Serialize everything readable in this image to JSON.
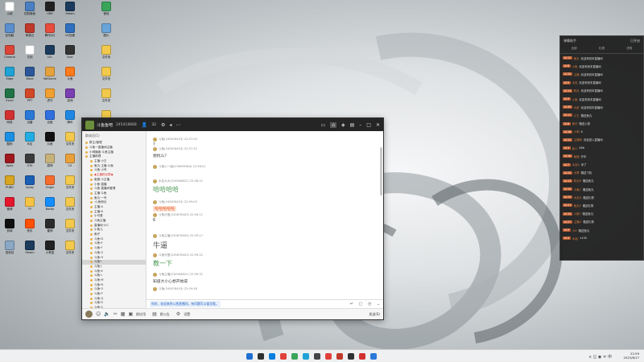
{
  "colors": {
    "accent_green": "#4b9a55",
    "danmu_bg": "#191919",
    "titlebar": "#252525"
  },
  "desktop": {
    "icons": [
      {
        "label": "火绒",
        "color": "#ffffff"
      },
      {
        "label": "控制面板",
        "color": "#4a7fc1"
      },
      {
        "label": "OBS",
        "color": "#222222"
      },
      {
        "label": "Steam",
        "color": "#1b3a5c"
      },
      {
        "label": "微信",
        "color": "#3aa55a"
      },
      {
        "label": "此电脑",
        "color": "#5a8fcf"
      },
      {
        "label": "网易云",
        "color": "#c0392b"
      },
      {
        "label": "腾讯QQ",
        "color": "#e74c3c"
      },
      {
        "label": "UU加速",
        "color": "#2f6fbf"
      },
      {
        "label": "图片",
        "color": "#6aa4d8"
      },
      {
        "label": "Chrome",
        "color": "#db4437"
      },
      {
        "label": "文档",
        "color": "#ffffff"
      },
      {
        "label": "LOL",
        "color": "#1b3a5c"
      },
      {
        "label": "Epic",
        "color": "#333333"
      },
      {
        "label": "文件夹",
        "color": "#f2c94c"
      },
      {
        "label": "Edge",
        "color": "#1fa2d6"
      },
      {
        "label": "Word",
        "color": "#2b579a"
      },
      {
        "label": "WeGame",
        "color": "#e5a23c"
      },
      {
        "label": "斗鱼",
        "color": "#ff7a1a"
      },
      {
        "label": "文件夹",
        "color": "#f2c94c"
      },
      {
        "label": "Excel",
        "color": "#217346"
      },
      {
        "label": "PPT",
        "color": "#d24726"
      },
      {
        "label": "虎牙",
        "color": "#f0a030"
      },
      {
        "label": "游戏",
        "color": "#7a3fb0"
      },
      {
        "label": "文件夹",
        "color": "#f2c94c"
      },
      {
        "label": "网易",
        "color": "#d23131"
      },
      {
        "label": "迅雷",
        "color": "#2a79d9"
      },
      {
        "label": "百度",
        "color": "#2f6fe0"
      },
      {
        "label": "腾讯",
        "color": "#1e88e5"
      },
      {
        "label": "资料",
        "color": "#f2c94c"
      },
      {
        "label": "酷狗",
        "color": "#1a8fe3"
      },
      {
        "label": "B站",
        "color": "#23ade5"
      },
      {
        "label": "抖音",
        "color": "#111111"
      },
      {
        "label": "文件夹",
        "color": "#f2c94c"
      },
      {
        "label": "文件夹",
        "color": "#f2c94c"
      },
      {
        "label": "Apex",
        "color": "#a0181e"
      },
      {
        "label": "GTA",
        "color": "#3b3b3b"
      },
      {
        "label": "原神",
        "color": "#c7b27a"
      },
      {
        "label": "CS",
        "color": "#e9a23b"
      },
      {
        "label": "文件夹",
        "color": "#f2c94c"
      },
      {
        "label": "PUBG",
        "color": "#d8a520"
      },
      {
        "label": "Uplay",
        "color": "#1a5fb4"
      },
      {
        "label": "Origin",
        "color": "#f56c2d"
      },
      {
        "label": "文件夹",
        "color": "#f2c94c"
      },
      {
        "label": "文件夹",
        "color": "#f2c94c"
      },
      {
        "label": "微博",
        "color": "#e6162d"
      },
      {
        "label": "YY",
        "color": "#f6c343"
      },
      {
        "label": "Battle",
        "color": "#148eff"
      },
      {
        "label": "文件夹",
        "color": "#f2c94c"
      },
      {
        "label": "文件夹",
        "color": "#f2c94c"
      },
      {
        "label": "剪映",
        "color": "#101010"
      },
      {
        "label": "快手",
        "color": "#ff5000"
      },
      {
        "label": "雷神",
        "color": "#2b2b2b"
      },
      {
        "label": "文件夹",
        "color": "#f2c94c"
      },
      {
        "label": "文件夹",
        "color": "#f2c94c"
      },
      {
        "label": "回收站",
        "color": "#8aa7c4"
      },
      {
        "label": "Steam",
        "color": "#1b3a5c"
      },
      {
        "label": "小黑盒",
        "color": "#222222"
      },
      {
        "label": "文件夹",
        "color": "#f2c94c"
      },
      {
        "label": "文件夹",
        "color": "#f2c94c"
      }
    ]
  },
  "chat": {
    "title": "斗鱼鱼吧",
    "id": "245418668",
    "member_count": "32",
    "sidebar_header": "群成员(1)",
    "members": [
      {
        "name": "群主/管理",
        "sel": false
      },
      {
        "name": "斗鱼一直播间主播",
        "sel": false
      },
      {
        "name": "小明播客·斗鱼主播",
        "sel": false
      },
      {
        "name": "主播助理",
        "sel": false
      },
      {
        "name": "主播·小王",
        "sel": false
      },
      {
        "name": "鱼丸·主播·斗鱼",
        "sel": false
      },
      {
        "name": "斗鱼·小号",
        "sel": false
      },
      {
        "name": "◆主播粉丝群◆",
        "sel": false
      },
      {
        "name": "鱼翅·小主播",
        "sel": false
      },
      {
        "name": "小鱼·直播",
        "sel": false
      },
      {
        "name": "斗鱼·直播间管理",
        "sel": false
      },
      {
        "name": "主播·斗鱼",
        "sel": false
      },
      {
        "name": "鱼丸·一号",
        "sel": false
      },
      {
        "name": "·小鱼粉丝",
        "sel": false
      },
      {
        "name": "主播·A",
        "sel": false
      },
      {
        "name": "主播·B",
        "sel": false
      },
      {
        "name": "小可爱",
        "sel": false
      },
      {
        "name": "斗鱼主播",
        "sel": false
      },
      {
        "name": "直播间·小C",
        "sel": false
      },
      {
        "name": "小鱼儿",
        "sel": false
      },
      {
        "name": "鱼仔",
        "sel": false
      },
      {
        "name": "斗鱼·D",
        "sel": false
      },
      {
        "name": "斗鱼·E",
        "sel": false
      },
      {
        "name": "斗鱼·F",
        "sel": false
      },
      {
        "name": "斗鱼·G",
        "sel": false
      },
      {
        "name": "斗鱼·H",
        "sel": false
      },
      {
        "name": "斗鱼·I",
        "sel": true
      },
      {
        "name": "斗鱼·J",
        "sel": false
      },
      {
        "name": "斗鱼·K",
        "sel": false
      },
      {
        "name": "斗鱼·L",
        "sel": false
      },
      {
        "name": "斗鱼·M",
        "sel": false
      },
      {
        "name": "斗鱼·N",
        "sel": false
      },
      {
        "name": "斗鱼·O",
        "sel": false
      },
      {
        "name": "斗鱼·P",
        "sel": false
      },
      {
        "name": "斗鱼·Q",
        "sel": false
      },
      {
        "name": "斗鱼·R",
        "sel": false
      },
      {
        "name": "斗鱼·S",
        "sel": false
      },
      {
        "name": "斗鱼·T",
        "sel": false
      }
    ],
    "messages": [
      {
        "meta": "斗鱼(245876403) 22:57:00",
        "body": "?",
        "style": ""
      },
      {
        "meta": "斗鱼(245876403) 22:57:32",
        "body": "想找么？",
        "style": ""
      },
      {
        "meta": "斗鱼小一级(476899384) 22:58:01",
        "body": "",
        "style": ""
      },
      {
        "meta": "水友大大(234948622) 22:58:21",
        "body": "哈哈哈哈",
        "style": "big"
      },
      {
        "meta": "斗鱼(245876403) 22:59:03",
        "body": "哈哈哈哈哈",
        "style": "red"
      },
      {
        "meta": "斗鱼可爱(245876403) 22:59:11",
        "body": "6",
        "style": ""
      },
      {
        "meta": "斗鱼主播(245876403) 22:59:17",
        "body": "牛逼",
        "style": "big2"
      },
      {
        "meta": "斗鱼可爱(245876403) 22:59:22",
        "body": "教一下",
        "style": "big"
      },
      {
        "meta": "斗鱼主播(234948622) 22:59:31",
        "body": "知道大小心想开始说",
        "style": ""
      },
      {
        "meta": "斗鱼(245876403) 22:59:38",
        "body": "",
        "style": ""
      }
    ],
    "input_text": "你好，欢迎来到斗鱼直播间，有问题可以留言哦。",
    "bottom_labels": [
      "群应用",
      "群公告",
      "设置"
    ],
    "send_label": "发送(S)"
  },
  "danmu": {
    "header": "弹幕助手",
    "header_right": "已开启",
    "tabs": [
      "全部",
      "礼物",
      "进场"
    ],
    "items": [
      {
        "tag": "LV.12",
        "name": "鱼丸",
        "text": "欢迎来到本直播间"
      },
      {
        "tag": "LV.8",
        "name": "小鱼",
        "text": "欢迎来到本直播间"
      },
      {
        "tag": "LV.20",
        "name": "主播",
        "text": "欢迎来到本直播间"
      },
      {
        "tag": "LV.5",
        "name": "水友",
        "text": "欢迎来到本直播间"
      },
      {
        "tag": "LV.14",
        "name": "粉丝",
        "text": "欢迎来到本直播间"
      },
      {
        "tag": "LV.9",
        "name": "斗鱼",
        "text": "欢迎来到本直播间"
      },
      {
        "tag": "LV.30",
        "name": "大佬",
        "text": "欢迎来到本直播间"
      },
      {
        "tag": "LV.11",
        "name": "小王",
        "text": "赠送鱼丸"
      },
      {
        "tag": "LV.6",
        "name": "鱼仔",
        "text": "赠送火箭"
      },
      {
        "tag": "LV.18",
        "name": "小明",
        "text": "6"
      },
      {
        "tag": "LV.22",
        "name": "主播粉",
        "text": "欢迎进入直播间"
      },
      {
        "tag": "LV.3",
        "name": "新人",
        "text": "666"
      },
      {
        "tag": "LV.16",
        "name": "鱼翅",
        "text": "开车"
      },
      {
        "tag": "LV.7",
        "name": "水友A",
        "text": "来了"
      },
      {
        "tag": "LV.25",
        "name": "大哥",
        "text": "赠送飞机"
      },
      {
        "tag": "LV.13",
        "name": "粉丝B",
        "text": "赠送鱼丸"
      },
      {
        "tag": "LV.10",
        "name": "小鱼C",
        "text": "赠送鱼丸"
      },
      {
        "tag": "LV.19",
        "name": "水友D",
        "text": "赠送礼物"
      },
      {
        "tag": "LV.21",
        "name": "鱼丸E",
        "text": "赠送礼物"
      },
      {
        "tag": "LV.15",
        "name": "斗鱼F",
        "text": "赠送鱼丸"
      },
      {
        "tag": "LV.27",
        "name": "主播G",
        "text": "赠送礼物"
      },
      {
        "tag": "LV.9",
        "name": "小H",
        "text": "赠送鱼丸"
      },
      {
        "tag": "LV.4",
        "name": "水友I",
        "text": "x100"
      }
    ]
  },
  "taskbar": {
    "apps": [
      "#1f6fd1",
      "#2f2f2f",
      "#0a7fe0",
      "#e0403a",
      "#3aa55a",
      "#1fa2d6",
      "#444444",
      "#e0403a",
      "#c0392b",
      "#2f2f2f",
      "#d23131",
      "#2b79d9"
    ],
    "time": "22:59",
    "date": "2023/8/17",
    "tray": "∧ ◫ ◉ ᯤ 中"
  }
}
